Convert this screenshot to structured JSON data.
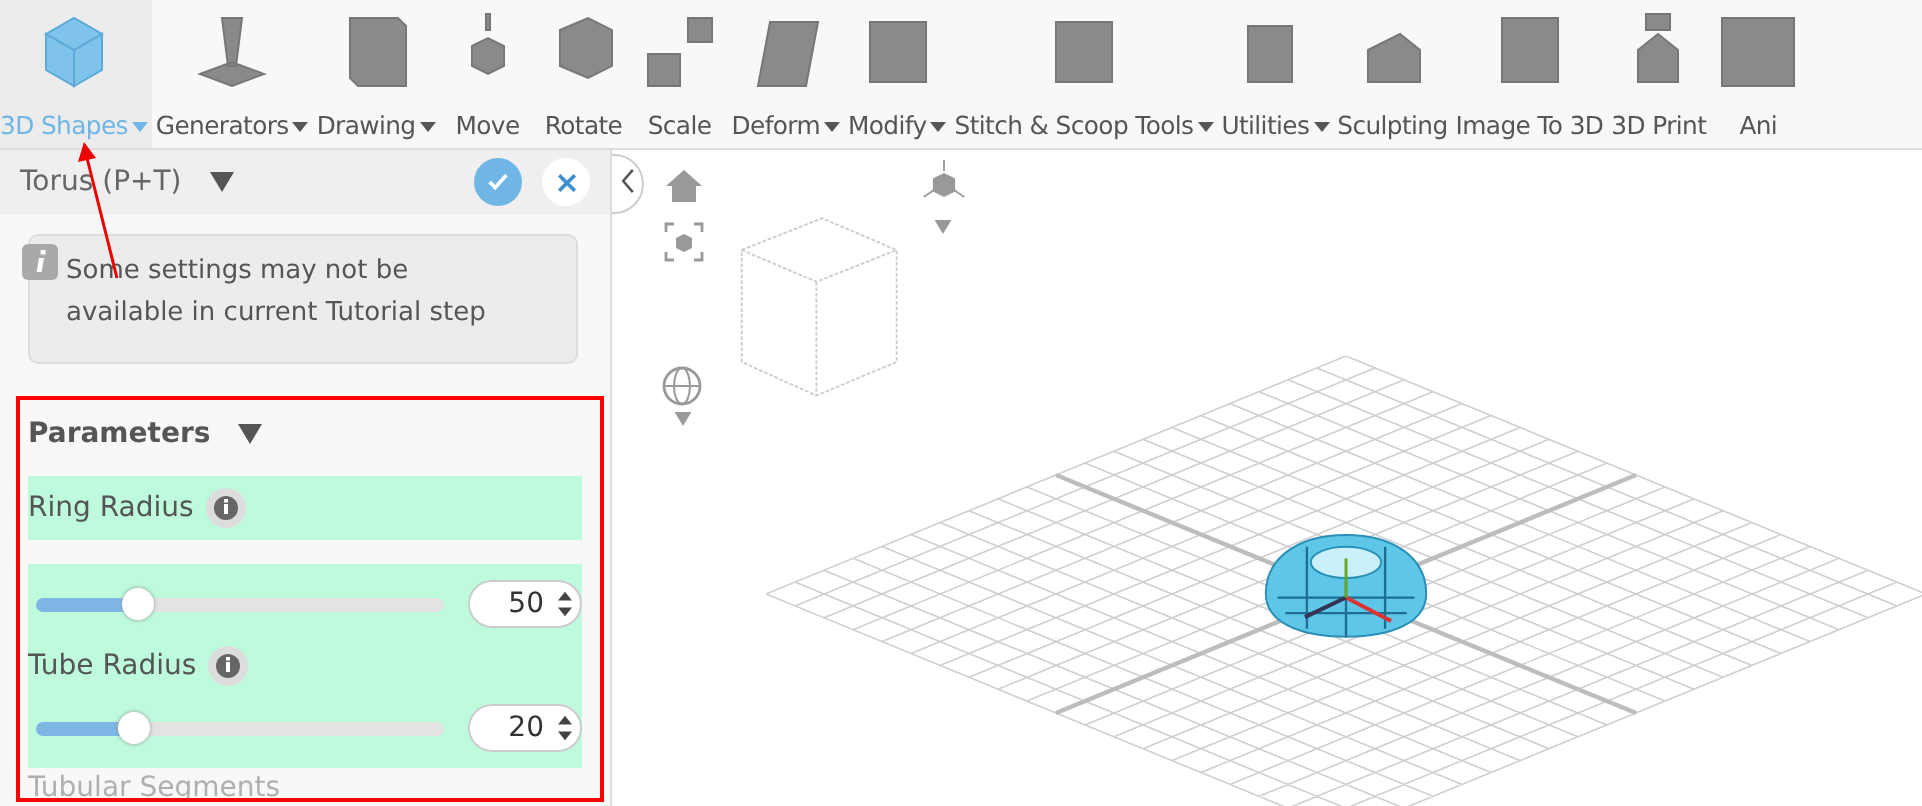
{
  "toolbar": {
    "items": [
      {
        "label": "3D Shapes",
        "dropdown": true,
        "selected": true
      },
      {
        "label": "Generators",
        "dropdown": true,
        "selected": false
      },
      {
        "label": "Drawing",
        "dropdown": true,
        "selected": false
      },
      {
        "label": "Move",
        "dropdown": false,
        "selected": false
      },
      {
        "label": "Rotate",
        "dropdown": false,
        "selected": false
      },
      {
        "label": "Scale",
        "dropdown": false,
        "selected": false
      },
      {
        "label": "Deform",
        "dropdown": true,
        "selected": false
      },
      {
        "label": "Modify",
        "dropdown": true,
        "selected": false
      },
      {
        "label": "Stitch & Scoop Tools",
        "dropdown": true,
        "selected": false
      },
      {
        "label": "Utilities",
        "dropdown": true,
        "selected": false
      },
      {
        "label": "Sculpting",
        "dropdown": false,
        "selected": false
      },
      {
        "label": "Image To 3D",
        "dropdown": false,
        "selected": false
      },
      {
        "label": "3D Print",
        "dropdown": false,
        "selected": false
      },
      {
        "label": "Ani",
        "dropdown": false,
        "selected": false
      }
    ]
  },
  "panel": {
    "title": "Torus (P+T)",
    "notice": "Some settings may not be available in current Tutorial step",
    "section": {
      "title": "Parameters",
      "params": [
        {
          "label": "Ring Radius",
          "level": 0.25,
          "value": "50"
        },
        {
          "label": "Tube Radius",
          "level": 0.24,
          "value": "20"
        }
      ],
      "next_param": {
        "label": "Tubular Segments",
        "disabled": true
      }
    }
  }
}
